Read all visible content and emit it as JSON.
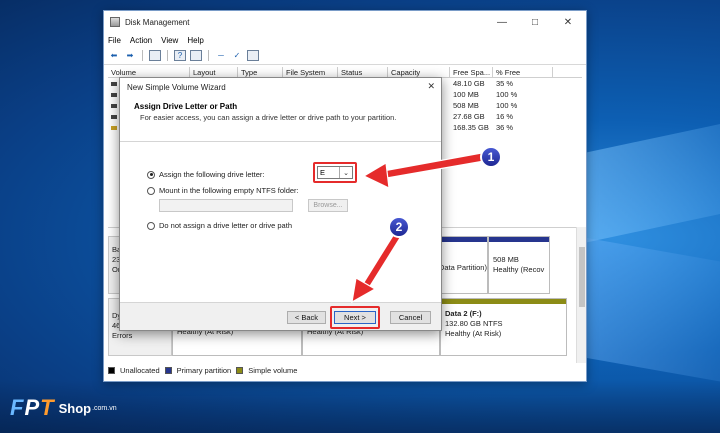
{
  "colors": {
    "highlight": "#e52b2b",
    "badge": "#2b3bb0",
    "unallocated": "#000000",
    "primary_partition": "#26358e",
    "simple_volume": "#8c8c16"
  },
  "window": {
    "title": "Disk Management",
    "menu": [
      "File",
      "Action",
      "View",
      "Help"
    ]
  },
  "volume_table": {
    "headers": [
      "Volume",
      "Layout",
      "Type",
      "File System",
      "Status",
      "Capacity",
      "Free Spa...",
      "% Free"
    ],
    "rows": [
      {
        "free": "48.10 GB",
        "pct": "35 %"
      },
      {
        "free": "100 MB",
        "pct": "100 %"
      },
      {
        "free": "508 MB",
        "pct": "100 %"
      },
      {
        "free": "27.68 GB",
        "pct": "16 %"
      },
      {
        "free": "168.35 GB",
        "pct": "36 %"
      }
    ]
  },
  "disks": {
    "disk0_label": [
      "Ba",
      "23",
      "On"
    ],
    "disk0_partitions": {
      "p1": "Data Partition)",
      "p2_size": "508 MB",
      "p2_status": "Healthy (Recov"
    },
    "disk1_label": [
      "Dy",
      "46",
      "Errors"
    ],
    "disk1_partitions": {
      "p1_status": "Healthy (At Risk)",
      "p2_status": "Healthy (At Risk)",
      "p3_status": "Healthy (At Risk)",
      "p4_name": "Data 2  (F:)",
      "p4_size": "132.80 GB NTFS",
      "p4_status": "Healthy (At Risk)"
    }
  },
  "legend": {
    "unallocated": "Unallocated",
    "primary": "Primary partition",
    "simple": "Simple volume"
  },
  "wizard": {
    "title": "New Simple Volume Wizard",
    "heading": "Assign Drive Letter or Path",
    "subheading": "For easier access, you can assign a drive letter or drive path to your partition.",
    "option_assign": "Assign the following drive letter:",
    "drive_letter": "E",
    "option_mount": "Mount in the following empty NTFS folder:",
    "browse": "Browse...",
    "option_none": "Do not assign a drive letter or drive path",
    "back": "< Back",
    "next": "Next >",
    "cancel": "Cancel"
  },
  "annotations": {
    "badge1": "1",
    "badge2": "2"
  },
  "logo": {
    "letters": [
      "F",
      "P",
      "T"
    ],
    "shop": "Shop",
    "domain": ".com.vn"
  }
}
